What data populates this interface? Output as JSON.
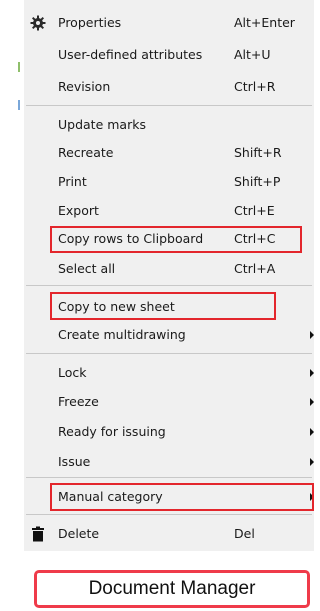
{
  "colors": {
    "menu_bg": "#f0f0f0",
    "highlight": "#e3262c",
    "title_border": "#ef3b4a"
  },
  "menu": {
    "properties": {
      "label": "Properties",
      "shortcut": "Alt+Enter",
      "icon": "gear-icon"
    },
    "user_attrs": {
      "label": "User-defined attributes",
      "shortcut": "Alt+U"
    },
    "revision": {
      "label": "Revision",
      "shortcut": "Ctrl+R"
    },
    "update_marks": {
      "label": "Update marks"
    },
    "recreate": {
      "label": "Recreate",
      "shortcut": "Shift+R"
    },
    "print": {
      "label": "Print",
      "shortcut": "Shift+P"
    },
    "export": {
      "label": "Export",
      "shortcut": "Ctrl+E"
    },
    "copy_rows": {
      "label": "Copy rows to Clipboard",
      "shortcut": "Ctrl+C"
    },
    "select_all": {
      "label": "Select all",
      "shortcut": "Ctrl+A"
    },
    "copy_new_sheet": {
      "label": "Copy to new sheet"
    },
    "create_multidrawing": {
      "label": "Create multidrawing",
      "submenu": true
    },
    "lock": {
      "label": "Lock",
      "submenu": true
    },
    "freeze": {
      "label": "Freeze",
      "submenu": true
    },
    "ready_issuing": {
      "label": "Ready for issuing",
      "submenu": true
    },
    "issue": {
      "label": "Issue",
      "submenu": true
    },
    "manual_category": {
      "label": "Manual category",
      "submenu": true
    },
    "delete": {
      "label": "Delete",
      "shortcut": "Del",
      "icon": "trash-icon"
    }
  },
  "footer": {
    "title": "Document Manager"
  }
}
